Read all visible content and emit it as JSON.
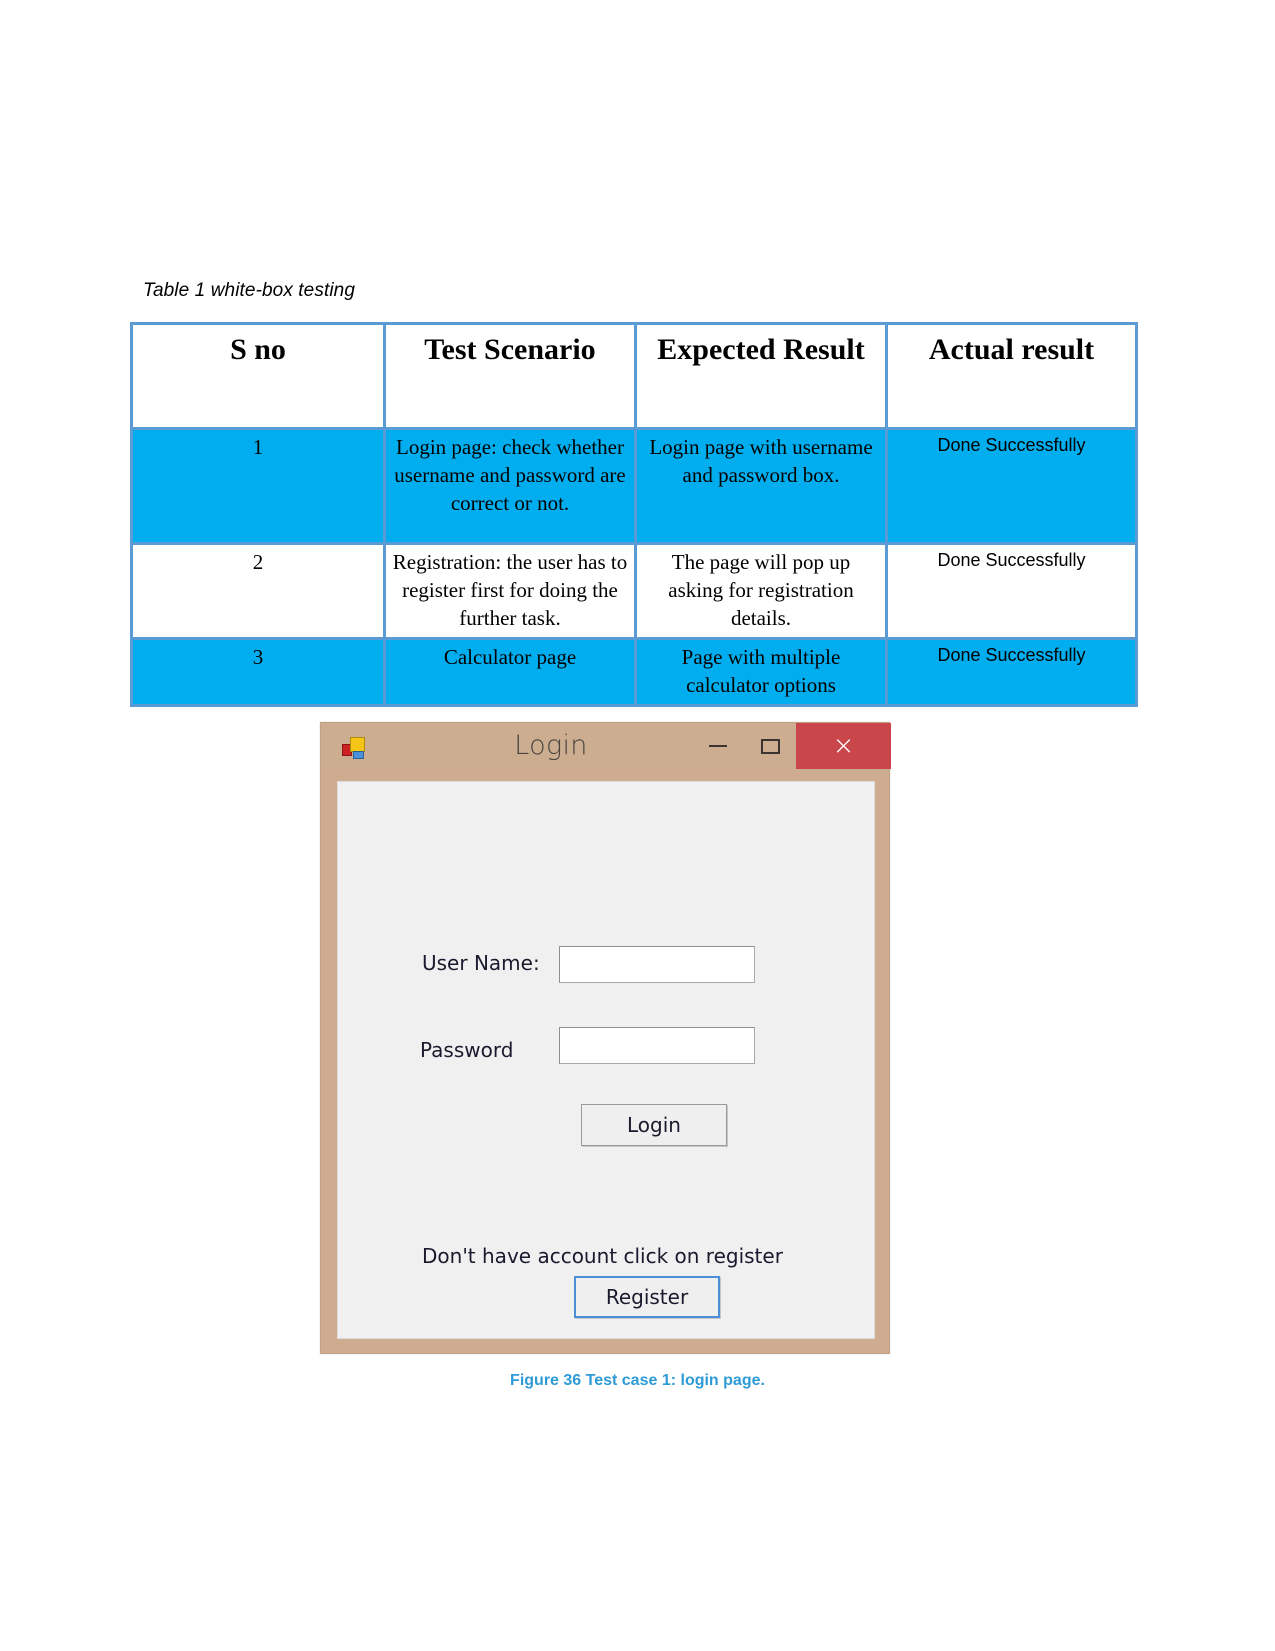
{
  "document": {
    "table_caption": "Table 1 white-box testing",
    "figure_caption": "Figure 36 Test case 1: login page."
  },
  "colors": {
    "table_border": "#5B9BD5",
    "row_highlight": "#00AEEF",
    "caption_blue": "#2E9BD6",
    "titlebar": "#cdad90",
    "close_button": "#c9474a",
    "form_background": "#f0f0f0",
    "focus_border": "#4a90d9"
  },
  "table": {
    "headers": [
      "S no",
      "Test Scenario",
      "Expected Result",
      "Actual result"
    ],
    "rows": [
      {
        "s_no": "1",
        "test_scenario": "Login page: check whether username and password are correct or not.",
        "expected_result": "Login page with username and password box.",
        "actual_result": "Done Successfully",
        "shaded": true
      },
      {
        "s_no": "2",
        "test_scenario": "Registration: the user has to register first for doing the further task.",
        "expected_result": "The page will pop up asking for registration details.",
        "actual_result": "Done Successfully",
        "shaded": false
      },
      {
        "s_no": "3",
        "test_scenario": "Calculator page",
        "expected_result": "Page with multiple calculator options",
        "actual_result": "Done Successfully",
        "shaded": true
      }
    ]
  },
  "login_window": {
    "title": "Login",
    "icon": "winforms-app-icon",
    "window_controls": {
      "minimize": "minimize-icon",
      "maximize": "maximize-icon",
      "close": "×"
    },
    "fields": {
      "username_label": "User Name:",
      "username_value": "",
      "username_placeholder": "",
      "password_label": "Password",
      "password_value": "",
      "password_placeholder": ""
    },
    "login_button": "Login",
    "register_hint": "Don't have account click on register",
    "register_button": "Register"
  }
}
